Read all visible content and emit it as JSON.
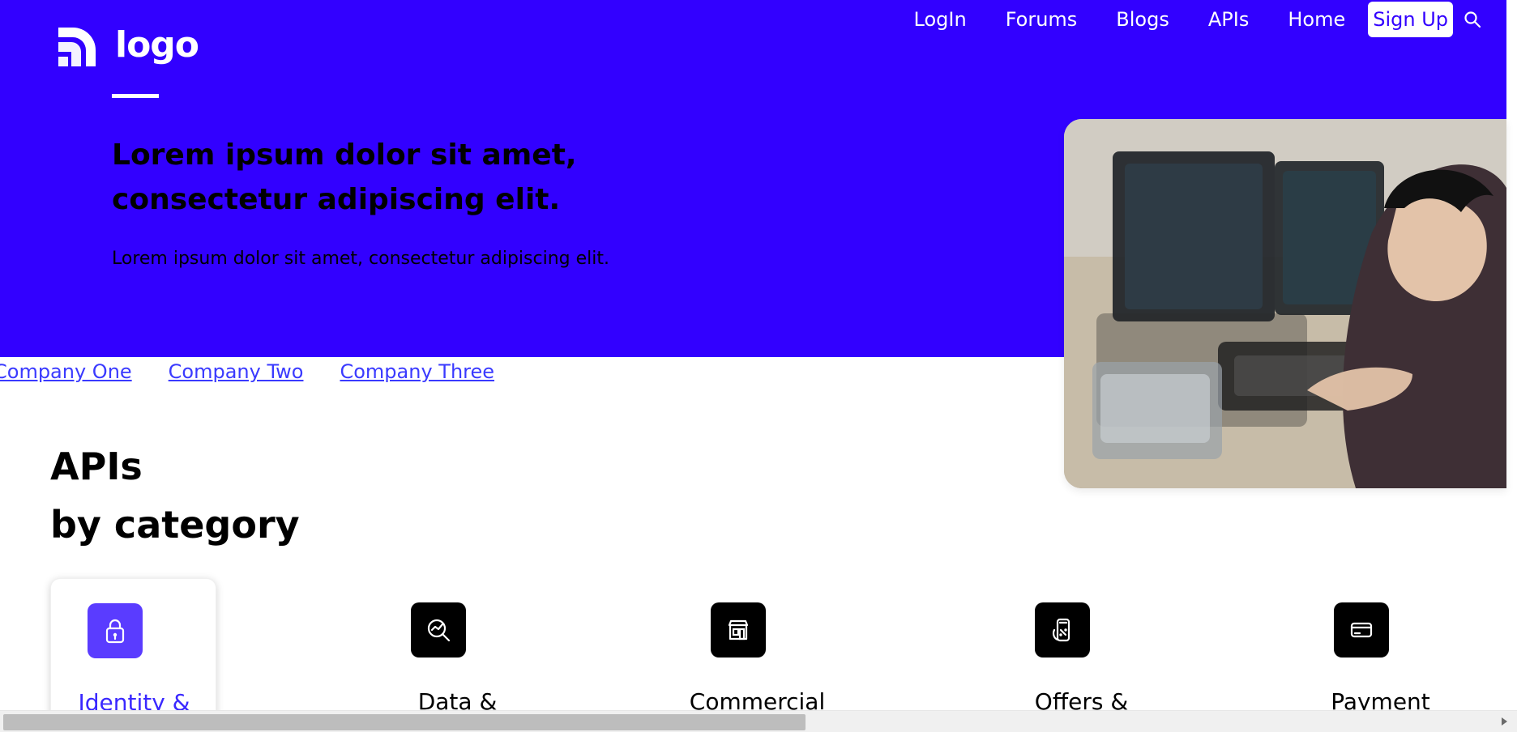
{
  "header": {
    "logo_text": "logo",
    "nav": [
      {
        "label": "LogIn"
      },
      {
        "label": "Forums"
      },
      {
        "label": "Blogs"
      },
      {
        "label": "APIs"
      },
      {
        "label": "Home"
      }
    ],
    "signup_label": "Sign Up",
    "icons": {
      "search": "search-icon"
    }
  },
  "hero": {
    "title_line1": "Lorem ipsum dolor sit amet,",
    "title_line2": "consectetur adipiscing elit.",
    "subtitle": "Lorem ipsum dolor sit amet, consectetur adipiscing elit."
  },
  "companies": [
    {
      "label": "Company One"
    },
    {
      "label": "Company Two"
    },
    {
      "label": "Company Three"
    }
  ],
  "section": {
    "title_line1": "APIs",
    "title_line2": "by category"
  },
  "categories": [
    {
      "label": "Identity &",
      "icon": "lock-icon",
      "active": true
    },
    {
      "label": "Data &",
      "icon": "analytics-icon",
      "active": false
    },
    {
      "label": "Commercial",
      "icon": "storefront-icon",
      "active": false
    },
    {
      "label": "Offers &",
      "icon": "offers-icon",
      "active": false
    },
    {
      "label": "Payment",
      "icon": "card-icon",
      "active": false
    }
  ],
  "colors": {
    "brand": "#3200ff",
    "active_icon_bg": "#5a3cff",
    "link": "#3a3aff"
  }
}
